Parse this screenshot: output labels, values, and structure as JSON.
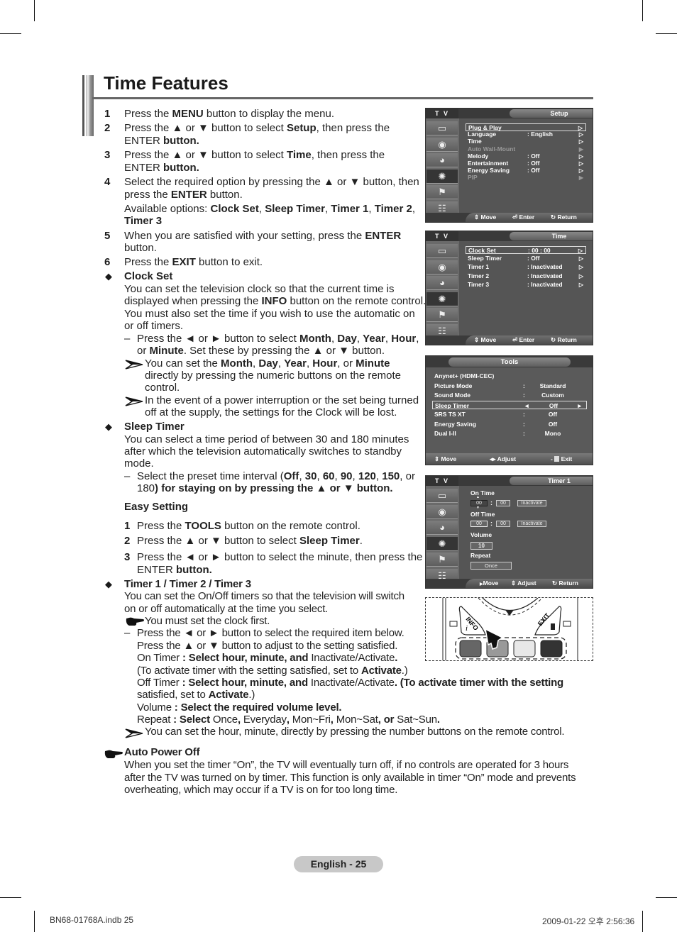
{
  "page": {
    "title": "Time Features",
    "footer_label": "English - 25",
    "slug_left": "BN68-01768A.indb   25",
    "slug_right": "2009-01-22   오후 2:56:36"
  },
  "steps": [
    {
      "num": "1",
      "parts": [
        "Press the ",
        "MENU",
        " button to display the menu."
      ]
    },
    {
      "num": "2",
      "line1": [
        "Press the ▲ or ▼ button to select ",
        "Setup",
        ", then press the"
      ],
      "line2": [
        "ENTER",
        " button."
      ]
    },
    {
      "num": "3",
      "line1": [
        "Press the ▲ or ▼ button to select ",
        "Time",
        ", then press the"
      ],
      "line2": [
        "ENTER",
        " button."
      ]
    },
    {
      "num": "4",
      "line1": "Select the required option by pressing the ▲ or ▼ button, then",
      "line2": [
        "press the ",
        "ENTER",
        " button."
      ],
      "available_prefix": "Available options: ",
      "available_options": [
        "Clock Set",
        "Sleep Timer",
        "Timer 1",
        "Timer 2",
        "Timer 3"
      ]
    },
    {
      "num": "5",
      "line1": [
        "When you are satisfied with your setting, press the ",
        "ENTER"
      ],
      "line2": "button."
    },
    {
      "num": "6",
      "parts": [
        "Press the ",
        "EXIT",
        " button to exit."
      ]
    }
  ],
  "clock_set": {
    "heading": "Clock Set",
    "desc": [
      "You can set the television clock so that the current time is",
      "displayed when pressing the ",
      "INFO",
      " button on the remote control.",
      "You must also set the time if you wish to use the automatic on",
      "or off timers."
    ],
    "dash1": [
      "Press the ◄ or ► button to select ",
      "Month",
      ", ",
      "Day",
      ", ",
      "Year",
      ", ",
      "Hour",
      ","
    ],
    "dash2": [
      "or ",
      "Minute",
      ". Set these by pressing the ▲ or ▼ button."
    ],
    "note1": [
      "You can set the ",
      "Month",
      ", ",
      "Day",
      ", ",
      "Year",
      ", ",
      "Hour",
      ", or ",
      "Minute"
    ],
    "note1b": "directly by pressing the numeric buttons on the remote",
    "note1c": "control.",
    "note2": "In the event of a power interruption or the set being turned",
    "note2b": "off at the supply, the settings for the Clock will be lost."
  },
  "sleep_timer": {
    "heading": "Sleep Timer",
    "desc1": "You can select a time period of between 30 and 180 minutes",
    "desc2": "after which the television automatically switches to standby",
    "desc3": "mode.",
    "dash1": [
      "Select the preset time interval (",
      "Off",
      ", ",
      "30",
      ", ",
      "60",
      ", ",
      "90",
      ", ",
      "120",
      ", ",
      "150",
      ", or"
    ],
    "dash2": [
      "180",
      ") for staying on by pressing the ▲ or ▼ button."
    ],
    "easy_heading": "Easy Setting",
    "easy_steps": [
      {
        "num": "1",
        "parts": [
          "Press the ",
          "TOOLS",
          " button on the remote control."
        ]
      },
      {
        "num": "2",
        "parts": [
          "Press the ▲ or ▼ button to select ",
          "Sleep Timer",
          "."
        ]
      },
      {
        "num": "3",
        "line1": "Press the ◄ or ► button to select the minute, then press the",
        "line2": [
          "ENTER",
          " button."
        ]
      }
    ]
  },
  "timers": {
    "heading": "Timer 1 / Timer 2 / Timer 3",
    "desc1": "You can set the On/Off timers so that the television will switch",
    "desc2": "on or off automatically at the time you select.",
    "note_hand": "You must set the clock first.",
    "dash1": "Press the ◄ or ► button to select the required item below.",
    "dash2": "Press the ▲ or ▼ button to adjust to the setting satisfied.",
    "on_timer": [
      "On Timer",
      " : Select hour, minute, and ",
      "Inactivate/Activate",
      "."
    ],
    "on_timer2": [
      "(To activate timer with the setting satisfied, set to ",
      "Activate",
      ".)"
    ],
    "off_timer": [
      "Off Timer",
      " : Select hour, minute, and ",
      "Inactivate/Activate",
      ". (To activate timer with the setting"
    ],
    "off_timer2": [
      "satisfied, set to ",
      "Activate",
      ".)"
    ],
    "volume": [
      "Volume",
      " : Select the required volume level."
    ],
    "repeat": [
      "Repeat",
      " : Select ",
      "Once",
      ", ",
      "Everyday",
      ", ",
      "Mon~Fri",
      ", ",
      "Mon~Sat",
      ", or ",
      "Sat~Sun",
      "."
    ],
    "note_arrow": "You can set the hour, minute, directly by pressing the number buttons on the remote control."
  },
  "auto_power_off": {
    "heading": "Auto Power Off",
    "lines": [
      "When you set the timer “On”, the TV will eventually turn off, if no controls are operated for 3 hours",
      "after the TV was turned on by timer. This function is only available in timer “On” mode and prevents",
      "overheating, which may occur if a TV is on for too long time."
    ]
  },
  "osd_setup": {
    "tv_label": "T V",
    "title": "Setup",
    "rows": [
      {
        "label": "Plug & Play",
        "value": "",
        "arrow": "▷",
        "selected": true
      },
      {
        "label": "Language",
        "value": ": English",
        "arrow": "▷"
      },
      {
        "label": "Time",
        "value": "",
        "arrow": "▷"
      },
      {
        "label": "Auto Wall-Mount",
        "value": "",
        "arrow": "▶",
        "dim": true
      },
      {
        "label": "Melody",
        "value": ": Off",
        "arrow": "▷"
      },
      {
        "label": "Entertainment",
        "value": ": Off",
        "arrow": "▷"
      },
      {
        "label": "Energy Saving",
        "value": ": Off",
        "arrow": "▷"
      },
      {
        "label": "PIP",
        "value": "",
        "arrow": "▶",
        "dim": true
      }
    ],
    "footer": {
      "move": "Move",
      "enter": "Enter",
      "return": "Return"
    }
  },
  "osd_time": {
    "tv_label": "T V",
    "title": "Time",
    "rows": [
      {
        "label": "Clock Set",
        "value": ": 00 : 00",
        "arrow": "▷",
        "selected": true
      },
      {
        "label": "Sleep Timer",
        "value": ": Off",
        "arrow": "▷"
      },
      {
        "label": "Timer 1",
        "value": ": Inactivated",
        "arrow": "▷"
      },
      {
        "label": "Timer 2",
        "value": ": Inactivated",
        "arrow": "▷"
      },
      {
        "label": "Timer 3",
        "value": ": Inactivated",
        "arrow": "▷"
      }
    ],
    "footer": {
      "move": "Move",
      "enter": "Enter",
      "return": "Return"
    }
  },
  "osd_tools": {
    "title": "Tools",
    "rows": [
      {
        "label": "Anynet+ (HDMI-CEC)",
        "sep": "",
        "value": ""
      },
      {
        "label": "Picture Mode",
        "sep": ":",
        "value": "Standard"
      },
      {
        "label": "Sound Mode",
        "sep": ":",
        "value": "Custom"
      },
      {
        "label": "Sleep Timer",
        "sep": "◄",
        "value": "Off",
        "right": "►",
        "selected": true
      },
      {
        "label": "SRS TS XT",
        "sep": ":",
        "value": "Off"
      },
      {
        "label": "Energy Saving",
        "sep": ":",
        "value": "Off"
      },
      {
        "label": "Dual I-II",
        "sep": ":",
        "value": "Mono"
      }
    ],
    "footer": {
      "move": "Move",
      "adjust": "Adjust",
      "exit": "Exit"
    }
  },
  "osd_timer1": {
    "tv_label": "T V",
    "title": "Timer 1",
    "on_time_label": "On Time",
    "on_hour": "00",
    "on_min": "00",
    "on_state": "Inactivate",
    "off_time_label": "Off Time",
    "off_hour": "00",
    "off_min": "00",
    "off_state": "Inactivate",
    "colon": ":",
    "volume_label": "Volume",
    "volume_value": "10",
    "repeat_label": "Repeat",
    "repeat_value": "Once",
    "footer": {
      "move": "Move",
      "adjust": "Adjust",
      "return": "Return"
    }
  },
  "remote": {
    "info_label": "INFO",
    "exit_label": "EXIT"
  }
}
